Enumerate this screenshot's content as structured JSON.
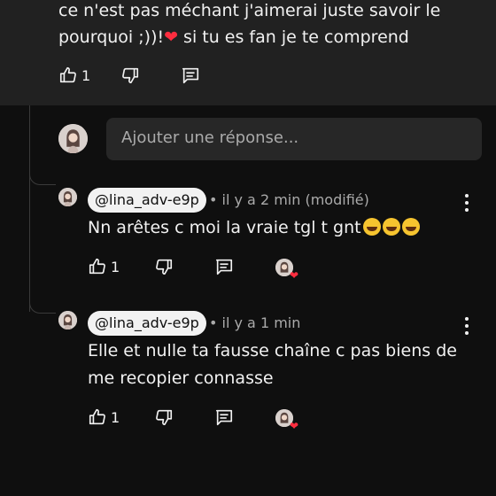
{
  "parent_comment": {
    "text_before_heart": "ce n'est pas méchant j'aimerai juste savoir le pourquoi ;))!",
    "heart_glyph": "❤",
    "text_after_heart": " si tu es fan je te comprend",
    "like_count": "1"
  },
  "reply_box": {
    "placeholder": "Ajouter une réponse..."
  },
  "replies": [
    {
      "handle": "@lina_adv-e9p",
      "meta": "• il y a 2 min (modifié)",
      "text": "Nn arêtes c moi la vraie tgl t gnt",
      "emoji_count": 3,
      "like_count": "1",
      "creator_heart": "❤"
    },
    {
      "handle": "@lina_adv-e9p",
      "meta": "• il y a 1 min",
      "text": "Elle et nulle ta fausse chaîne c pas biens de me recopier connasse",
      "emoji_count": 0,
      "like_count": "1",
      "creator_heart": "❤"
    }
  ],
  "icons": {
    "like": "thumb-up-icon",
    "dislike": "thumb-down-icon",
    "reply": "comment-icon",
    "more": "more-vert-icon"
  },
  "colors": {
    "background": "#0f0f0f",
    "highlighted_comment_bg": "#212121",
    "input_bg": "#272727",
    "handle_bg": "#f2f2f2",
    "heart": "#ff2d3f"
  }
}
